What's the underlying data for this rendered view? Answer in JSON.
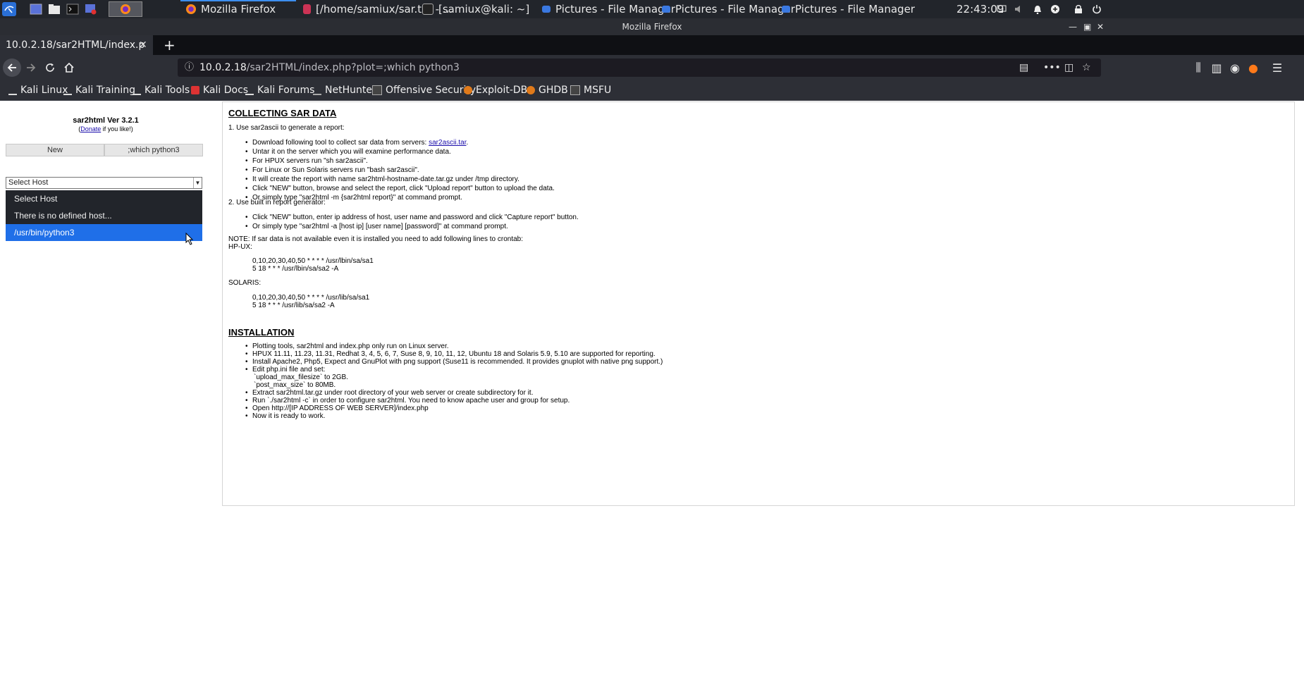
{
  "taskbar": {
    "tasks": [
      "Mozilla Firefox",
      "[/home/samiux/sar.txt - ...",
      "[samiux@kali: ~]",
      "Pictures - File Manager",
      "Pictures - File Manager",
      "Pictures - File Manager"
    ],
    "clock": "22:43:09"
  },
  "window": {
    "title": "Mozilla Firefox"
  },
  "browser": {
    "tab_title": "10.0.2.18/sar2HTML/index.p",
    "url_host": "10.0.2.18",
    "url_path": "/sar2HTML/index.php?plot=;which python3",
    "bookmarks": [
      "Kali Linux",
      "Kali Training",
      "Kali Tools",
      "Kali Docs",
      "Kali Forums",
      "NetHunter",
      "Offensive Security",
      "Exploit-DB",
      "GHDB",
      "MSFU"
    ]
  },
  "sidebar": {
    "version": "sar2html Ver 3.2.1",
    "donate_open": "(",
    "donate_link": "Donate",
    "donate_rest": " if you like!)",
    "new_button": "New",
    "plot_button": ";which python3",
    "select_value": "Select Host",
    "options": [
      "Select Host",
      "There is no defined host...",
      "/usr/bin/python3"
    ],
    "selected_option": "/usr/bin/python3"
  },
  "main": {
    "section1_title": "COLLECTING SAR DATA",
    "step1": "1. Use sar2ascii to generate a report:",
    "step1_items": [
      "Download following tool to collect sar data from servers: ",
      "Untar it on the server which you will examine performance data.",
      "For HPUX servers run \"sh sar2ascii\".",
      "For Linux or Sun Solaris servers run \"bash sar2ascii\".",
      "It will create the report with name sar2html-hostname-date.tar.gz under /tmp directory.",
      "Click \"NEW\" button, browse and select the report, click \"Upload report\" button to upload the data.",
      "Or simply type \"sar2html -m {sar2html report}\" at command prompt."
    ],
    "step1_link": "sar2ascii.tar",
    "step1_link_end": ".",
    "step2": "2. Use built in report generator:",
    "step2_items": [
      "Click \"NEW\" button, enter ip address of host, user name and password and click \"Capture report\" button.",
      "Or simply type \"sar2html -a [host ip] [user name] [password]\" at command prompt."
    ],
    "note": "NOTE: If sar data is not available even it is installed you need to add following lines to crontab:",
    "hpux_label": "HP-UX:",
    "hpux_lines": [
      "0,10,20,30,40,50 * * * * /usr/lbin/sa/sa1",
      "5 18 * * * /usr/lbin/sa/sa2 -A"
    ],
    "solaris_label": "SOLARIS:",
    "solaris_lines": [
      "0,10,20,30,40,50 * * * * /usr/lib/sa/sa1",
      "5 18 * * * /usr/lib/sa/sa2 -A"
    ],
    "section2_title": "INSTALLATION",
    "install_items": [
      "Plotting tools, sar2html and index.php only run on Linux server.",
      "HPUX 11.11, 11.23, 11.31, Redhat 3, 4, 5, 6, 7, Suse 8, 9, 10, 11, 12, Ubuntu 18 and Solaris 5.9, 5.10 are supported for reporting.",
      "Install Apache2, Php5, Expect and GnuPlot with png support (Suse11 is recommended. It provides gnuplot with native png support.)",
      "Edit php.ini file and set:",
      "`upload_max_filesize` to 2GB.",
      "`post_max_size` to 80MB.",
      "Extract sar2html.tar.gz under root directory of your web server or create subdirectory for it.",
      "Run `./sar2html -c` in order to configure sar2html. You need to know apache user and group for setup.",
      "Open http://[IP ADDRESS OF WEB SERVER]/index.php",
      "Now it is ready to work."
    ]
  }
}
